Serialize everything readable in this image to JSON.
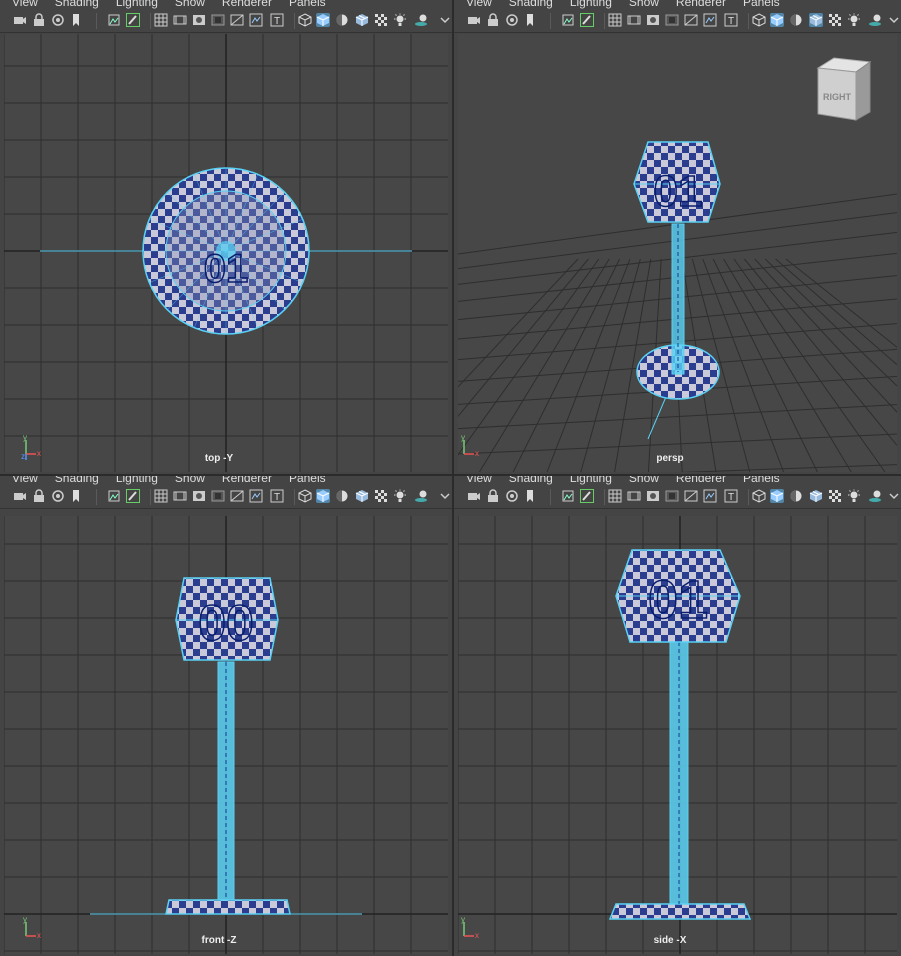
{
  "menu": [
    "View",
    "Shading",
    "Lighting",
    "Show",
    "Renderer",
    "Panels"
  ],
  "viewports": [
    {
      "camera": "top -Y"
    },
    {
      "camera": "persp",
      "viewcube": "RIGHT"
    },
    {
      "camera": "front -Z"
    },
    {
      "camera": "side -X"
    }
  ],
  "model_labels": {
    "top": "01",
    "front": "00",
    "side": "01"
  },
  "axis_labels": {
    "x": "x",
    "y": "y",
    "z": "z"
  },
  "colors": {
    "selection": "#5ad2f4",
    "checker_dark": "#2a3d8f",
    "checker_light": "#c9c9d9",
    "grid": "#2e2e2e",
    "background": "#474747"
  },
  "icons": [
    "camera-icon",
    "camera-lock-icon",
    "camera-attributes-icon",
    "bookmark-icon",
    "image-plane-icon",
    "grease-pencil-icon",
    "grid-icon",
    "film-gate-icon",
    "resolution-gate-icon",
    "gate-mask-icon",
    "field-chart-icon",
    "safe-action-icon",
    "safe-title-icon",
    "wireframe-icon",
    "smooth-shade-icon",
    "default-material-icon",
    "wireframe-on-shaded-icon",
    "textured-icon",
    "use-all-lights-icon",
    "shadows-icon"
  ]
}
